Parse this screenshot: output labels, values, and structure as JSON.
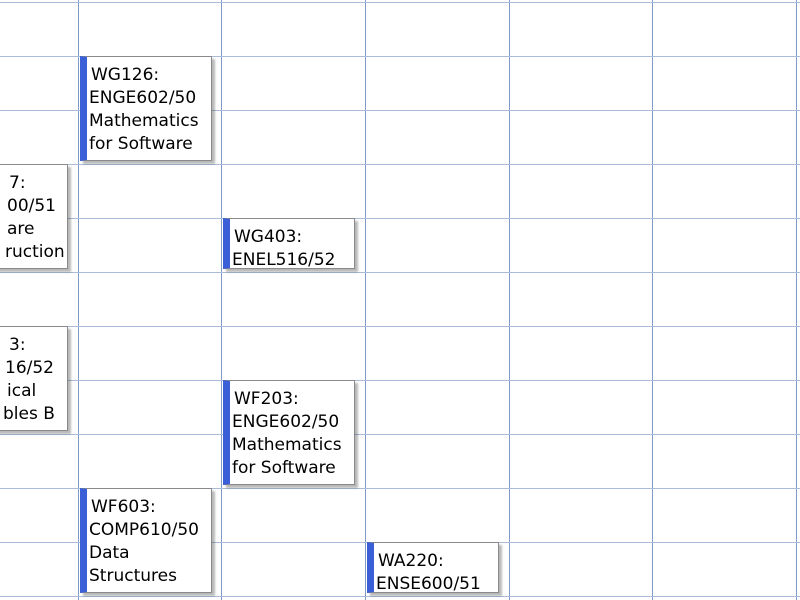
{
  "calendar": {
    "events": [
      {
        "room": "WG126:",
        "course": "ENGE602/50",
        "title_lines": [
          "Mathematics",
          "for Software"
        ]
      },
      {
        "room": "7:",
        "course": "00/51",
        "title_lines": [
          "are",
          "ruction"
        ]
      },
      {
        "room": "WG403:",
        "course": "ENEL516/52",
        "title_lines": []
      },
      {
        "room": "3:",
        "course": "16/52",
        "title_lines": [
          "ical",
          "bles B"
        ]
      },
      {
        "room": "WF203:",
        "course": "ENGE602/50",
        "title_lines": [
          "Mathematics",
          "for Software"
        ]
      },
      {
        "room": "WF603:",
        "course": "COMP610/50",
        "title_lines": [
          "Data",
          "Structures"
        ]
      },
      {
        "room": "WA220:",
        "course": "ENSE600/51",
        "title_lines": []
      }
    ],
    "accent_color": "#3b5fd6",
    "grid_color": "#7f9ac4"
  }
}
